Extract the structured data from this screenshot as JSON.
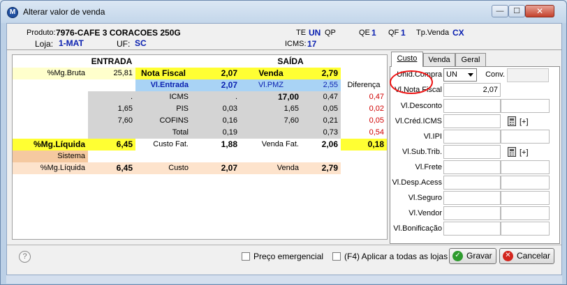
{
  "window": {
    "title": "Alterar valor de venda",
    "app_icon": "M"
  },
  "info": {
    "produto_label": "Produto:",
    "produto_value": "7976-CAFE 3 CORACOES 250G",
    "loja_label": "Loja:",
    "loja_value": "1-MAT",
    "uf_label": "UF:",
    "uf_value": "SC",
    "te_label": "TE",
    "te_value": "UN",
    "qp_label": "QP",
    "qe_label": "QE",
    "qe_value": "1",
    "qf_label": "QF",
    "qf_value": "1",
    "tpvenda_label": "Tp.Venda",
    "tpvenda_value": "CX",
    "icms_label": "ICMS:",
    "icms_value": "17"
  },
  "grid": {
    "entrada_header": "ENTRADA",
    "saida_header": "SAÍDA",
    "mg_bruta_label": "%Mg.Bruta",
    "mg_bruta_value": "25,81",
    "nota_fiscal_label": "Nota Fiscal",
    "nota_fiscal_value": "2,07",
    "venda_label": "Venda",
    "venda_value": "2,79",
    "vl_entrada_label": "Vl.Entrada",
    "vl_entrada_value": "2,07",
    "vl_pmz_label": "Vl.PMZ",
    "vl_pmz_value": "2,55",
    "diferenca_label": "Diferença",
    "icms_row": {
      "e_base": ".",
      "label": "ICMS",
      "e_val": ".",
      "s_base": "17,00",
      "s_val": "0,47",
      "dif": "0,47"
    },
    "pis_row": {
      "e_base": "1,65",
      "label": "PIS",
      "e_val": "0,03",
      "s_base": "1,65",
      "s_val": "0,05",
      "dif": "0,02"
    },
    "cofins_row": {
      "e_base": "7,60",
      "label": "COFINS",
      "e_val": "0,16",
      "s_base": "7,60",
      "s_val": "0,21",
      "dif": "0,05"
    },
    "total_row": {
      "label": "Total",
      "e_val": "0,19",
      "s_val": "0,73",
      "dif": "0,54"
    },
    "mg_liquida_label": "%Mg.Líquida",
    "mg_liquida_value": "6,45",
    "custo_fat_label": "Custo Fat.",
    "custo_fat_value": "1,88",
    "venda_fat_label": "Venda Fat.",
    "venda_fat_value": "2,06",
    "venda_fat_dif": "0,18",
    "sistema_label": "Sistema",
    "sis_mg_liquida_label": "%Mg.Líquida",
    "sis_mg_liquida_value": "6,45",
    "sis_custo_label": "Custo",
    "sis_custo_value": "2,07",
    "sis_venda_label": "Venda",
    "sis_venda_value": "2,79"
  },
  "tabs": [
    {
      "label": "Custo"
    },
    {
      "label": "Venda"
    },
    {
      "label": "Geral"
    }
  ],
  "form": {
    "unid_compra_label": "Unid.Compra",
    "unid_compra_value": "UN",
    "conv_label": "Conv.",
    "vl_nota_fiscal_label": "Vl.Nota Fiscal",
    "vl_nota_fiscal_value": "2,07",
    "vl_desconto_label": "Vl.Desconto",
    "vl_cred_icms_label": "Vl.Créd.ICMS",
    "vl_ipi_label": "Vl.IPI",
    "vl_sub_trib_label": "Vl.Sub.Trib.",
    "vl_frete_label": "Vl.Frete",
    "vl_desp_acess_label": "Vl.Desp.Acess",
    "vl_seguro_label": "Vl.Seguro",
    "vl_vendor_label": "Vl.Vendor",
    "vl_bonificacao_label": "Vl.Bonificação",
    "plus_label": "[+]"
  },
  "footer": {
    "preco_emergencial": "Preço emergencial",
    "aplicar_todas": "(F4) Aplicar a todas as lojas",
    "gravar": "Gravar",
    "cancelar": "Cancelar",
    "help": "?"
  },
  "colors": {
    "yellow": "#ffff33",
    "light_yellow": "#ffffcc",
    "blue_row": "#a9d3f5",
    "gray": "#d4d4d4",
    "orange": "#f5c9a0",
    "orange_light": "#fde3cc"
  }
}
